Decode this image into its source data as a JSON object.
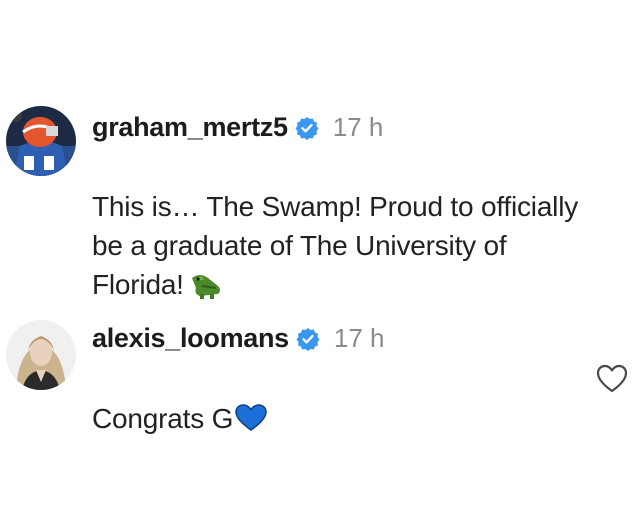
{
  "comments": [
    {
      "username": "graham_mertz5",
      "verified": true,
      "time": "17 h",
      "text": "This is… The Swamp! Proud to officially\nbe a graduate of The University of\nFlorida!",
      "emoji": "alligator-icon",
      "avatar": "football-player-avatar"
    },
    {
      "username": "alexis_loomans",
      "verified": true,
      "time": "17 h",
      "text": "Congrats G",
      "emoji": "blue-heart-icon",
      "avatar": "woman-portrait-avatar",
      "like_icon": "heart-outline-icon"
    }
  ],
  "colors": {
    "verified_badge": "#3897f0",
    "timestamp": "#8a8a8a",
    "blue_heart": "#1d6fd8",
    "alligator": "#4a8a2a"
  }
}
